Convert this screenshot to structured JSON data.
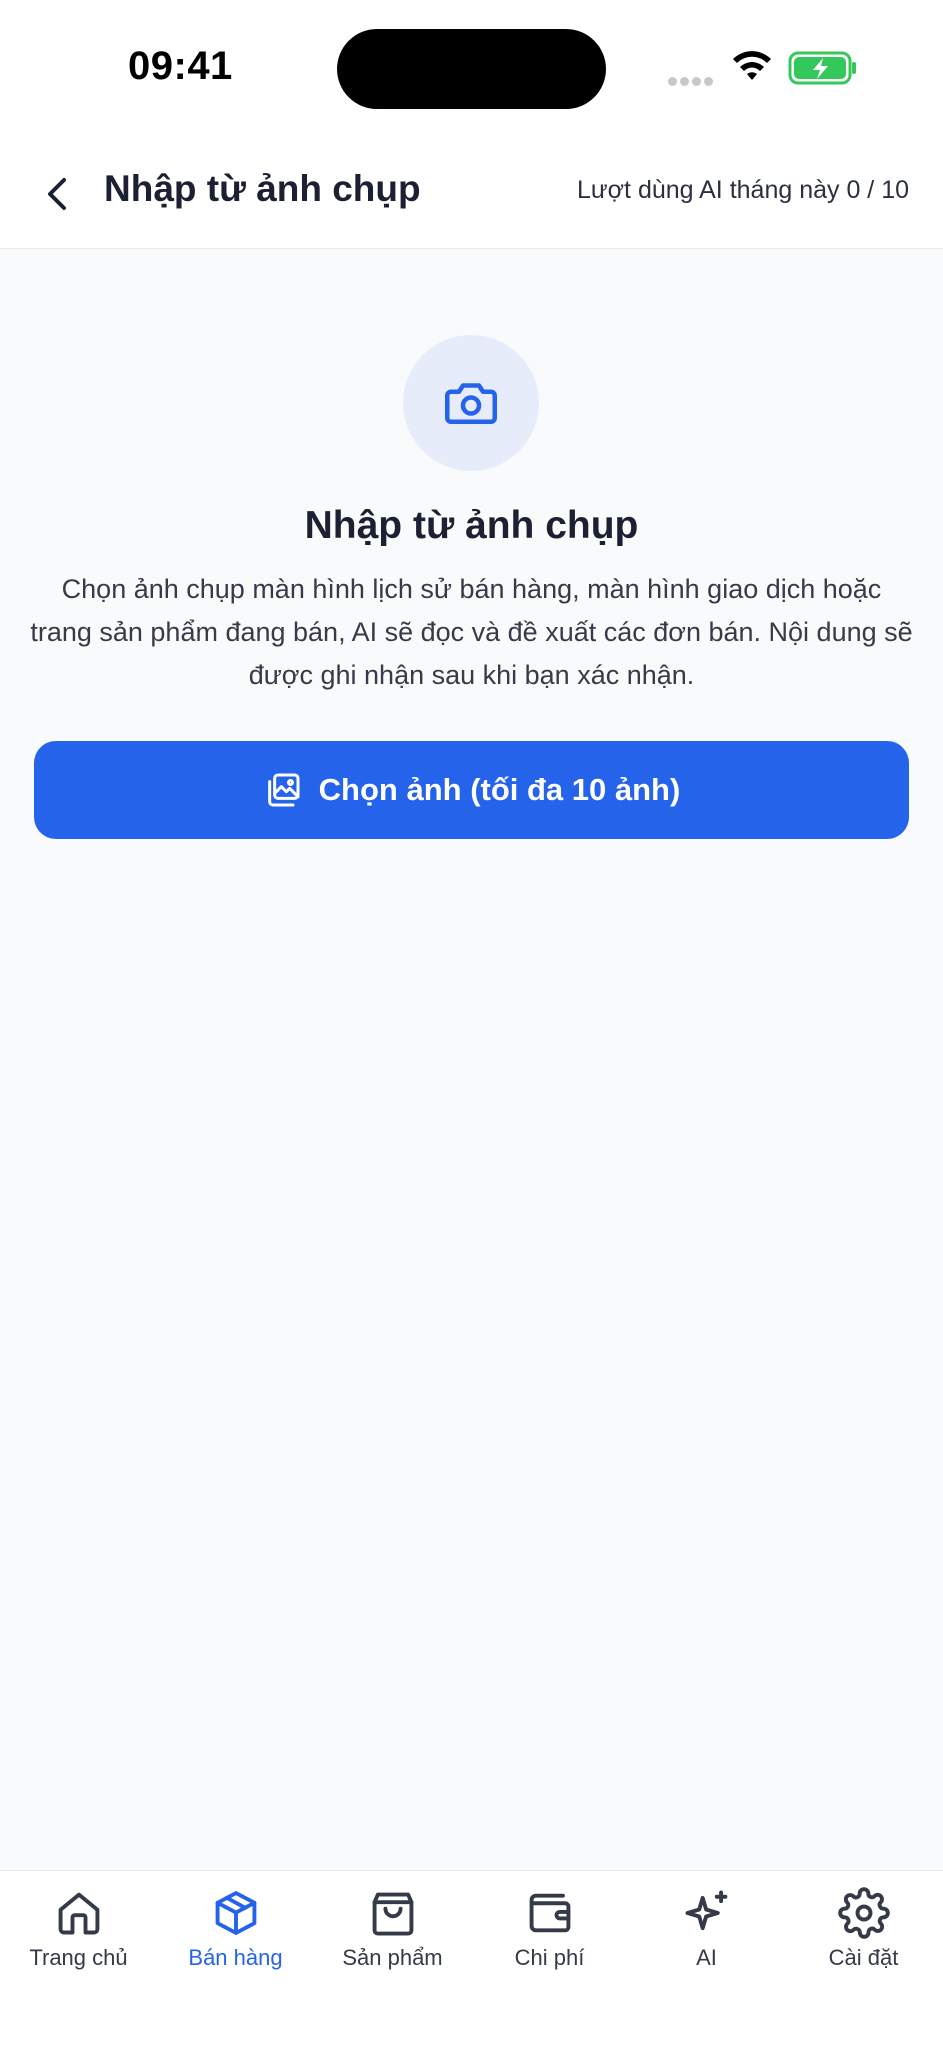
{
  "status_bar": {
    "time": "09:41"
  },
  "header": {
    "title": "Nhập từ ảnh chụp",
    "ai_usage": "Lượt dùng AI tháng này 0 / 10"
  },
  "main": {
    "icon": "camera-icon",
    "title": "Nhập từ ảnh chụp",
    "description": "Chọn ảnh chụp màn hình lịch sử bán hàng, màn hình giao dịch hoặc trang sản phẩm đang bán, AI sẽ đọc và đề xuất các đơn bán. Nội dung sẽ được ghi nhận sau khi bạn xác nhận.",
    "choose_button": {
      "label": "Chọn ảnh (tối đa 10 ảnh)",
      "icon": "images-icon"
    }
  },
  "tabbar": {
    "items": [
      {
        "label": "Trang chủ",
        "icon": "home-icon",
        "active": false
      },
      {
        "label": "Bán hàng",
        "icon": "box-icon",
        "active": true
      },
      {
        "label": "Sản phẩm",
        "icon": "shopping-bag-icon",
        "active": false
      },
      {
        "label": "Chi phí",
        "icon": "wallet-icon",
        "active": false
      },
      {
        "label": "AI",
        "icon": "sparkles-icon",
        "active": false
      },
      {
        "label": "Cài đặt",
        "icon": "gear-icon",
        "active": false
      }
    ]
  },
  "colors": {
    "accent": "#2563eb",
    "background": "#f9fafb",
    "icon_circle": "#e6ecfa",
    "battery_green": "#34c759"
  }
}
